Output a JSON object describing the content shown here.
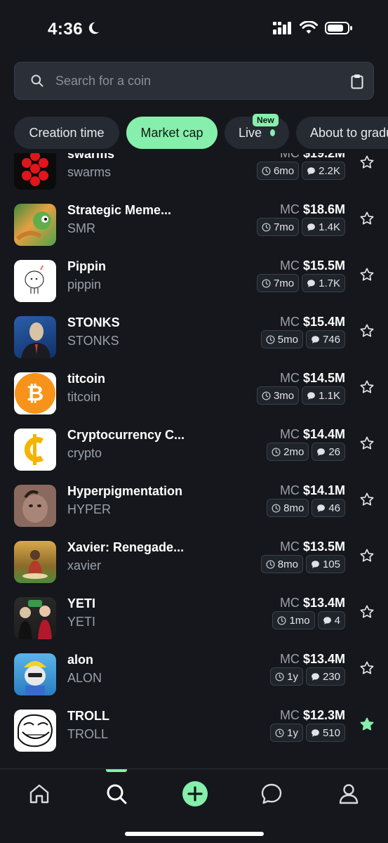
{
  "status": {
    "time": "4:36"
  },
  "search": {
    "placeholder": "Search for a coin"
  },
  "filters": [
    {
      "label": "Creation time"
    },
    {
      "label": "Market cap"
    },
    {
      "label": "Live",
      "badge": "New"
    },
    {
      "label": "About to graduate"
    }
  ],
  "accent_color": "#86efac",
  "coins": [
    {
      "name": "swarms",
      "ticker": "swarms",
      "mc_label": "MC",
      "mc": "$19.2M",
      "age": "6mo",
      "replies": "2.2K",
      "starred": false
    },
    {
      "name": "Strategic Meme...",
      "ticker": "SMR",
      "mc_label": "MC",
      "mc": "$18.6M",
      "age": "7mo",
      "replies": "1.4K",
      "starred": false
    },
    {
      "name": "Pippin",
      "ticker": "pippin",
      "mc_label": "MC",
      "mc": "$15.5M",
      "age": "7mo",
      "replies": "1.7K",
      "starred": false
    },
    {
      "name": "STONKS",
      "ticker": "STONKS",
      "mc_label": "MC",
      "mc": "$15.4M",
      "age": "5mo",
      "replies": "746",
      "starred": false
    },
    {
      "name": "titcoin",
      "ticker": "titcoin",
      "mc_label": "MC",
      "mc": "$14.5M",
      "age": "3mo",
      "replies": "1.1K",
      "starred": false
    },
    {
      "name": "Cryptocurrency C...",
      "ticker": "crypto",
      "mc_label": "MC",
      "mc": "$14.4M",
      "age": "2mo",
      "replies": "26",
      "starred": false
    },
    {
      "name": "Hyperpigmentation",
      "ticker": "HYPER",
      "mc_label": "MC",
      "mc": "$14.1M",
      "age": "8mo",
      "replies": "46",
      "starred": false
    },
    {
      "name": "Xavier: Renegade...",
      "ticker": "xavier",
      "mc_label": "MC",
      "mc": "$13.5M",
      "age": "8mo",
      "replies": "105",
      "starred": false
    },
    {
      "name": "YETI",
      "ticker": "YETI",
      "mc_label": "MC",
      "mc": "$13.4M",
      "age": "1mo",
      "replies": "4",
      "starred": false
    },
    {
      "name": "alon",
      "ticker": "ALON",
      "mc_label": "MC",
      "mc": "$13.4M",
      "age": "1y",
      "replies": "230",
      "starred": false
    },
    {
      "name": "TROLL",
      "ticker": "TROLL",
      "mc_label": "MC",
      "mc": "$12.3M",
      "age": "1y",
      "replies": "510",
      "starred": true
    }
  ],
  "nav": [
    {
      "icon": "home-icon"
    },
    {
      "icon": "search-icon",
      "active": true
    },
    {
      "icon": "plus-icon"
    },
    {
      "icon": "chat-icon"
    },
    {
      "icon": "profile-icon"
    }
  ]
}
